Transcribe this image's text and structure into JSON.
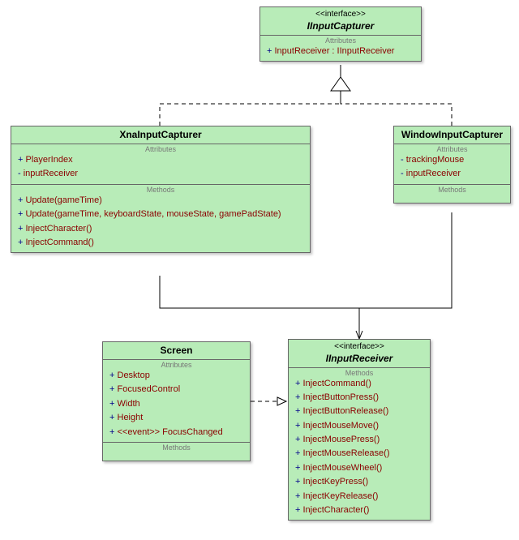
{
  "classes": {
    "iinputCapturer": {
      "stereo": "<<interface>>",
      "name": "IInputCapturer",
      "italic": true,
      "attrLabel": "Attributes",
      "attrs": [
        {
          "vis": "+",
          "sig": "InputReceiver",
          "type": " : IInputReceiver"
        }
      ]
    },
    "xnaInputCapturer": {
      "name": "XnaInputCapturer",
      "attrLabel": "Attributes",
      "attrs": [
        {
          "vis": "+",
          "sig": "PlayerIndex"
        },
        {
          "vis": "-",
          "sig": "inputReceiver"
        }
      ],
      "methLabel": "Methods",
      "methods": [
        {
          "vis": "+",
          "sig": "Update(gameTime)"
        },
        {
          "vis": "+",
          "sig": "Update(gameTime, keyboardState, mouseState, gamePadState)"
        },
        {
          "vis": "+",
          "sig": "InjectCharacter()"
        },
        {
          "vis": "+",
          "sig": "InjectCommand()"
        }
      ]
    },
    "windowInputCapturer": {
      "name": "WindowInputCapturer",
      "attrLabel": "Attributes",
      "attrs": [
        {
          "vis": "-",
          "sig": "trackingMouse"
        },
        {
          "vis": "-",
          "sig": "inputReceiver"
        }
      ],
      "methLabel": "Methods"
    },
    "screen": {
      "name": "Screen",
      "attrLabel": "Attributes",
      "attrs": [
        {
          "vis": "+",
          "sig": "Desktop"
        },
        {
          "vis": "+",
          "sig": "FocusedControl"
        },
        {
          "vis": "+",
          "sig": "Width"
        },
        {
          "vis": "+",
          "sig": "Height"
        },
        {
          "vis": "+",
          "sig": "<<event>> FocusChanged"
        }
      ],
      "methLabel": "Methods"
    },
    "iinputReceiver": {
      "stereo": "<<interface>>",
      "name": "IInputReceiver",
      "italic": true,
      "methLabel": "Methods",
      "methods": [
        {
          "vis": "+",
          "sig": "InjectCommand()"
        },
        {
          "vis": "+",
          "sig": "InjectButtonPress()"
        },
        {
          "vis": "+",
          "sig": "InjectButtonRelease()"
        },
        {
          "vis": "+",
          "sig": "InjectMouseMove()"
        },
        {
          "vis": "+",
          "sig": "InjectMousePress()"
        },
        {
          "vis": "+",
          "sig": "InjectMouseRelease()"
        },
        {
          "vis": "+",
          "sig": "InjectMouseWheel()"
        },
        {
          "vis": "+",
          "sig": "InjectKeyPress()"
        },
        {
          "vis": "+",
          "sig": "InjectKeyRelease()"
        },
        {
          "vis": "+",
          "sig": "InjectCharacter()"
        }
      ]
    }
  }
}
